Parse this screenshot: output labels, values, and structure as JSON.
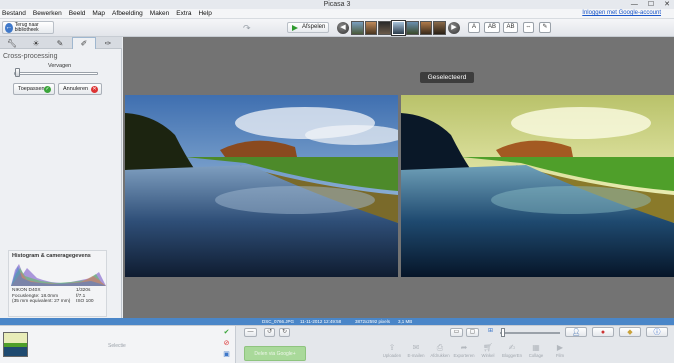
{
  "window": {
    "title": "Picasa 3",
    "controls": [
      "—",
      "☐",
      "✕"
    ]
  },
  "menu": {
    "items": [
      "Bestand",
      "Bewerken",
      "Beeld",
      "Map",
      "Afbeelding",
      "Maken",
      "Extra",
      "Help"
    ],
    "sign_in": "Inloggen met Google-account"
  },
  "toolbar": {
    "back_label": "Terug naar bibliotheek",
    "play_label": "Afspelen",
    "text_buttons": [
      "A",
      "AB",
      "AB"
    ]
  },
  "left_panel": {
    "tab_icons": [
      "wrench-icon",
      "sun-icon",
      "brush-icon",
      "effects-icon",
      "effects2-icon"
    ],
    "effect_name": "Cross-processing",
    "slider_label": "Vervagen",
    "slider_value": 0.05,
    "apply_label": "Toepassen",
    "cancel_label": "Annuleren",
    "histogram": {
      "title": "Histogram & cameragegevens",
      "camera": "NIKON D40X",
      "focal_length": "Focuslengte: 18.0mm",
      "equiv": "(35 mm equivalent: 27 mm)",
      "shutter": "1/320s",
      "aperture": "f/7.1",
      "iso": "ISO 100"
    }
  },
  "viewer": {
    "selected_label": "Geselecteerd"
  },
  "status": {
    "filename": "DSC_0766.JPG",
    "datetime": "11-11-2012 12:49:58",
    "dimensions": "3872x2592 pixels",
    "filesize": "3,1 MB"
  },
  "bottom": {
    "selection_label": "Selectie",
    "share_label": "Delen via Google+",
    "actions": [
      "Uploaden",
      "E-mailen",
      "Afdrukken",
      "Exporteren",
      "Winkel",
      "BloggerEn",
      "Collage",
      "Film"
    ]
  },
  "colors": {
    "accent": "#4a86c8",
    "viewer_bg": "#737373",
    "ok": "#3aa53a",
    "cancel": "#dd3333"
  }
}
